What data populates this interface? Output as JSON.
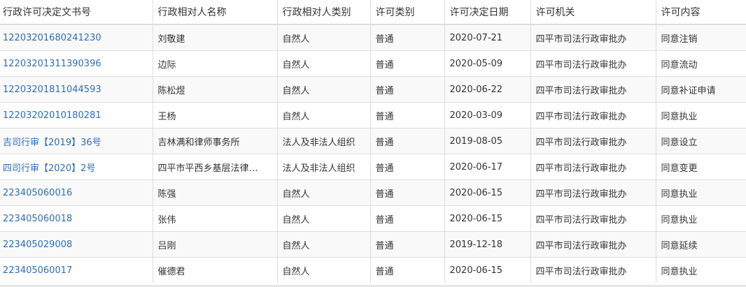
{
  "headers": [
    "行政许可决定文书号",
    "行政相对人名称",
    "行政相对人类别",
    "许可类别",
    "许可决定日期",
    "许可机关",
    "许可内容"
  ],
  "rows": [
    [
      "12203201680241230",
      "刘敬建",
      "自然人",
      "普通",
      "2020-07-21",
      "四平市司法行政审批办",
      "同意注销"
    ],
    [
      "12203201311390396",
      "边际",
      "自然人",
      "普通",
      "2020-05-09",
      "四平市司法行政审批办",
      "同意流动"
    ],
    [
      "12203201811044593",
      "陈松煜",
      "自然人",
      "普通",
      "2020-06-22",
      "四平市司法行政审批办",
      "同意补证申请"
    ],
    [
      "12203202010180281",
      "王杨",
      "自然人",
      "普通",
      "2020-03-09",
      "四平市司法行政审批办",
      "同意执业"
    ],
    [
      "吉司行审【2019】36号",
      "吉林满和律师事务所",
      "法人及非法人组织",
      "普通",
      "2019-08-05",
      "四平市司法行政审批办",
      "同意设立"
    ],
    [
      "四司行审【2020】2号",
      "四平市平西乡基层法律…",
      "法人及非法人组织",
      "普通",
      "2020-06-17",
      "四平市司法行政审批办",
      "同意变更"
    ],
    [
      "223405060016",
      "陈强",
      "自然人",
      "普通",
      "2020-06-15",
      "四平市司法行政审批办",
      "同意执业"
    ],
    [
      "223405060018",
      "张伟",
      "自然人",
      "普通",
      "2020-06-15",
      "四平市司法行政审批办",
      "同意执业"
    ],
    [
      "223405029008",
      "吕刚",
      "自然人",
      "普通",
      "2019-12-18",
      "四平市司法行政审批办",
      "同意延续"
    ],
    [
      "223405060017",
      "催德君",
      "自然人",
      "普通",
      "2020-06-15",
      "四平市司法行政审批办",
      "同意执业"
    ]
  ],
  "colors": {
    "link": "#2a6ebb",
    "border": "#dddddd",
    "stripe": "#f9f9f9"
  }
}
